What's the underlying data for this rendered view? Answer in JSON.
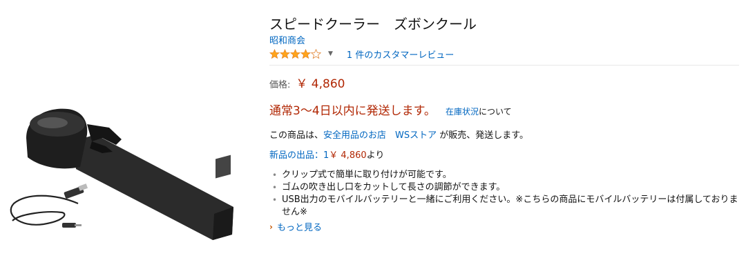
{
  "product": {
    "title": "スピードクーラー　ズボンクール",
    "brand": "昭和商会",
    "rating": {
      "stars": 4,
      "max": 5,
      "review_link": "1 件のカスタマーレビュー"
    },
    "price": {
      "label": "価格:",
      "value": "￥ 4,860"
    },
    "shipping": {
      "text": "通常3～4日以内に発送します。",
      "stock_link": "在庫状況",
      "stock_suffix": "について"
    },
    "seller": {
      "prefix": "この商品は、",
      "store1": "安全用品のお店　WSストア",
      "suffix": " が販売、発送します。"
    },
    "new_offers": {
      "link_label": "新品の出品：1",
      "price": "￥ 4,860",
      "suffix": "より"
    },
    "bullets": [
      "クリップ式で簡単に取り付けが可能です。",
      "ゴムの吹き出し口をカットして長さの調節ができます。",
      "USB出力のモバイルバッテリーと一緒にご利用ください。※こちらの商品にモバイルバッテリーは付属しておりません※"
    ],
    "see_more": "もっと見る"
  },
  "colors": {
    "link": "#0066c0",
    "price": "#b12704",
    "star": "#ffa41c"
  },
  "icons": {
    "rating_caret": "caret-down-icon",
    "see_more": "chevron-right-icon"
  }
}
